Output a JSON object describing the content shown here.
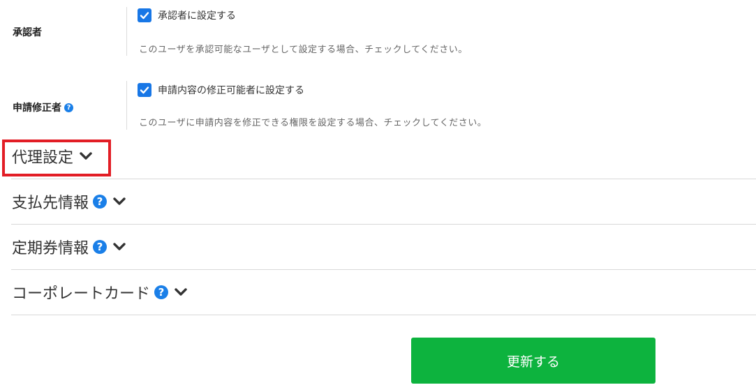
{
  "approver": {
    "label": "承認者",
    "checkbox_label": "承認者に設定する",
    "checked": true,
    "help": "このユーザを承認可能なユーザとして設定する場合、チェックしてください。"
  },
  "request_editor": {
    "label": "申請修正者",
    "checkbox_label": "申請内容の修正可能者に設定する",
    "checked": true,
    "help": "このユーザに申請内容を修正できる権限を設定する場合、チェックしてください。"
  },
  "sections": [
    {
      "title": "代理設定",
      "has_help": false
    },
    {
      "title": "支払先情報",
      "has_help": true
    },
    {
      "title": "定期券情報",
      "has_help": true
    },
    {
      "title": "コーポレートカード",
      "has_help": true
    }
  ],
  "icons": {
    "help": "question-circle-icon",
    "expand": "chevron-down-icon",
    "check": "checkmark-icon"
  },
  "colors": {
    "accent": "#1a7fe8",
    "button": "#0db33e",
    "highlight": "#e21d25"
  },
  "submit_label": "更新する"
}
